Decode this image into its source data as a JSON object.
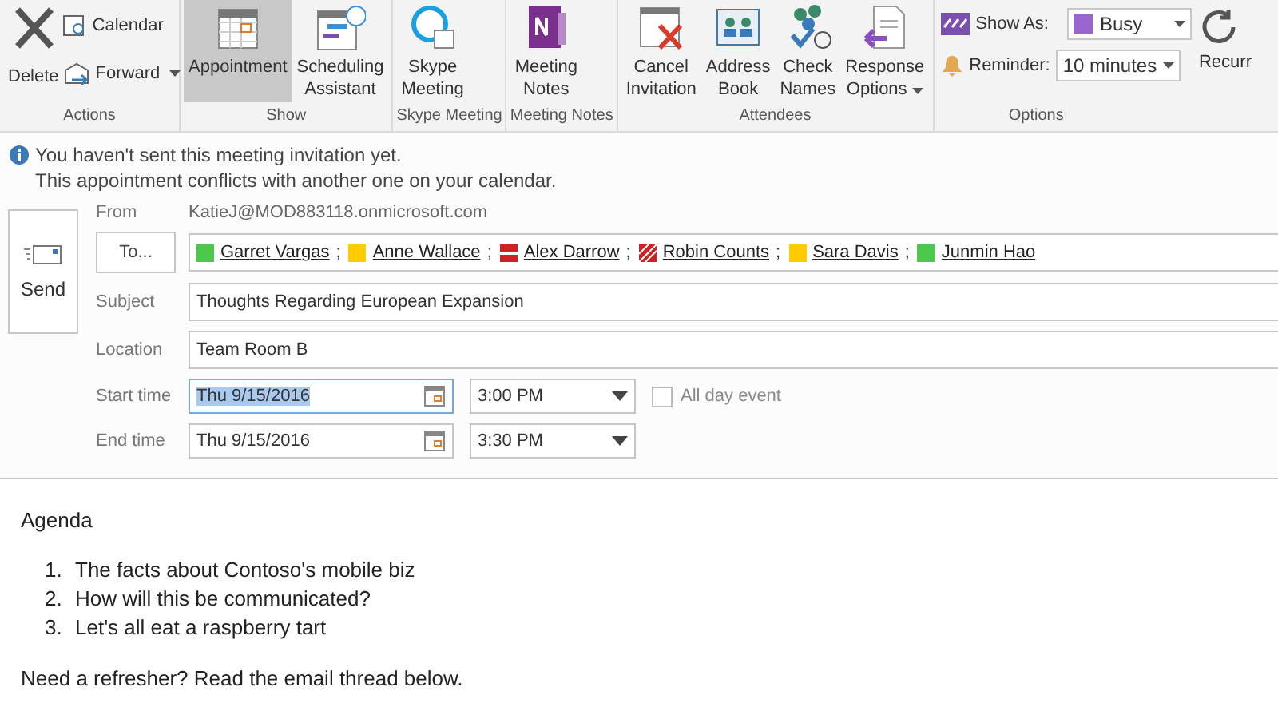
{
  "ribbon": {
    "actions": {
      "label": "Actions",
      "delete": "Delete",
      "calendar": "Calendar",
      "forward": "Forward"
    },
    "groups": [
      {
        "label": "Show",
        "buttons": [
          {
            "lines": [
              "Appointment"
            ],
            "selected": true,
            "dropdown": false
          },
          {
            "lines": [
              "Scheduling",
              "Assistant"
            ],
            "selected": false,
            "dropdown": false
          }
        ]
      },
      {
        "label": "Skype Meeting",
        "buttons": [
          {
            "lines": [
              "Skype",
              "Meeting"
            ],
            "selected": false,
            "dropdown": false
          }
        ]
      },
      {
        "label": "Meeting Notes",
        "buttons": [
          {
            "lines": [
              "Meeting",
              "Notes"
            ],
            "selected": false,
            "dropdown": false
          }
        ]
      },
      {
        "label": "Attendees",
        "buttons": [
          {
            "lines": [
              "Cancel",
              "Invitation"
            ],
            "selected": false,
            "dropdown": false
          },
          {
            "lines": [
              "Address",
              "Book"
            ],
            "selected": false,
            "dropdown": false
          },
          {
            "lines": [
              "Check",
              "Names"
            ],
            "selected": false,
            "dropdown": false
          },
          {
            "lines": [
              "Response",
              "Options"
            ],
            "selected": false,
            "dropdown": true
          }
        ]
      }
    ],
    "options": {
      "label": "Options",
      "show_as_label": "Show As:",
      "show_as": "Busy",
      "reminder_label": "Reminder:",
      "reminder": "10 minutes",
      "recurrence": "Recurr"
    }
  },
  "info": {
    "messages": [
      "You haven't sent this meeting invitation yet.",
      "This appointment conflicts with another one on your calendar."
    ]
  },
  "form": {
    "send": "Send",
    "from_label": "From",
    "from": "KatieJ@MOD883118.onmicrosoft.com",
    "to_button": "To...",
    "attendees": [
      {
        "name": "Garret Vargas",
        "separator": ";",
        "color": "#4cc94c",
        "kind": "solid"
      },
      {
        "name": "Anne Wallace",
        "separator": ";",
        "color": "#ffcc00",
        "kind": "solid"
      },
      {
        "name": "Alex Darrow",
        "separator": ";",
        "color": "#cc2222",
        "kind": "bar"
      },
      {
        "name": "Robin Counts",
        "separator": ";",
        "color": "#cc2222",
        "kind": "hatch"
      },
      {
        "name": "Sara Davis",
        "separator": ";",
        "color": "#ffcc00",
        "kind": "solid"
      },
      {
        "name": "Junmin Hao",
        "color": "#4cc94c",
        "kind": "solid"
      }
    ],
    "subject_label": "Subject",
    "subject": "Thoughts Regarding European Expansion",
    "location_label": "Location",
    "location": "Team Room B",
    "start_label": "Start time",
    "start_date": {
      "value": "Thu 9/15/2016",
      "selected": true
    },
    "start_time": "3:00 PM",
    "all_day": {
      "label": "All day event",
      "checked": false
    },
    "end_label": "End time",
    "end_date": {
      "value": "Thu 9/15/2016",
      "selected": false
    },
    "end_time": "3:30 PM"
  },
  "body": {
    "heading": "Agenda",
    "items": [
      {
        "marker": "1.",
        "text": "The facts about Contoso's mobile biz"
      },
      {
        "marker": "2.",
        "text": "How will this be communicated?"
      },
      {
        "marker": "3.",
        "text": "Let's all eat a raspberry tart"
      }
    ],
    "footer": "Need a refresher? Read the email thread below."
  }
}
